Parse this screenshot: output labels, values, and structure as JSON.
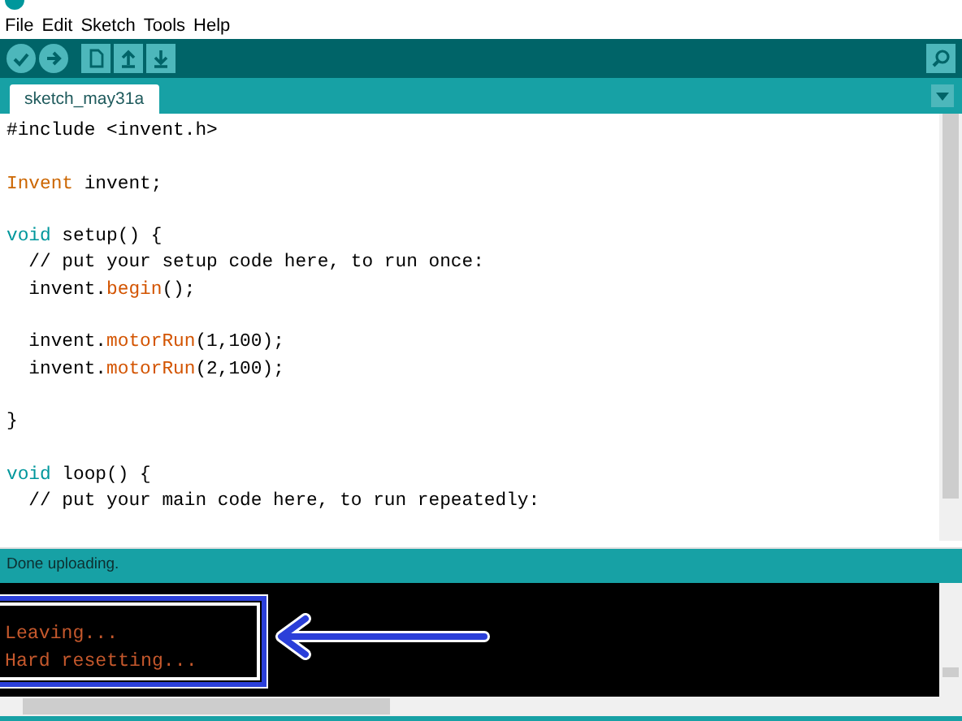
{
  "menu": [
    "File",
    "Edit",
    "Sketch",
    "Tools",
    "Help"
  ],
  "tabs": [
    {
      "label": "sketch_may31a",
      "selected": true
    }
  ],
  "editor": {
    "lines": [
      {
        "kind": "code",
        "segments": [
          {
            "text": "#include <invent.h>",
            "kind": "plain"
          }
        ]
      },
      {
        "kind": "blank"
      },
      {
        "kind": "code",
        "segments": [
          {
            "text": "Invent",
            "kind": "type"
          },
          {
            "text": " invent;",
            "kind": "plain"
          }
        ]
      },
      {
        "kind": "blank"
      },
      {
        "kind": "code",
        "segments": [
          {
            "text": "void",
            "kind": "keyword"
          },
          {
            "text": " setup() {",
            "kind": "plain"
          }
        ]
      },
      {
        "kind": "code",
        "segments": [
          {
            "text": "  // put your setup code here, to run once:",
            "kind": "plain"
          }
        ]
      },
      {
        "kind": "code",
        "segments": [
          {
            "text": "  invent.",
            "kind": "plain"
          },
          {
            "text": "begin",
            "kind": "function"
          },
          {
            "text": "();",
            "kind": "plain"
          }
        ]
      },
      {
        "kind": "blank"
      },
      {
        "kind": "code",
        "segments": [
          {
            "text": "  invent.",
            "kind": "plain"
          },
          {
            "text": "motorRun",
            "kind": "function"
          },
          {
            "text": "(1,100);",
            "kind": "plain"
          }
        ]
      },
      {
        "kind": "code",
        "segments": [
          {
            "text": "  invent.",
            "kind": "plain"
          },
          {
            "text": "motorRun",
            "kind": "function"
          },
          {
            "text": "(2,100);",
            "kind": "plain"
          }
        ]
      },
      {
        "kind": "blank"
      },
      {
        "kind": "code",
        "segments": [
          {
            "text": "}",
            "kind": "plain"
          }
        ]
      },
      {
        "kind": "blank"
      },
      {
        "kind": "code",
        "segments": [
          {
            "text": "void",
            "kind": "keyword"
          },
          {
            "text": " loop() {",
            "kind": "plain"
          }
        ]
      },
      {
        "kind": "code",
        "segments": [
          {
            "text": "  // put your main code here, to run repeatedly:",
            "kind": "plain"
          }
        ]
      }
    ]
  },
  "status_bar": "Done uploading.",
  "console": {
    "lines": [
      "Leaving...",
      "Hard resetting..."
    ]
  }
}
